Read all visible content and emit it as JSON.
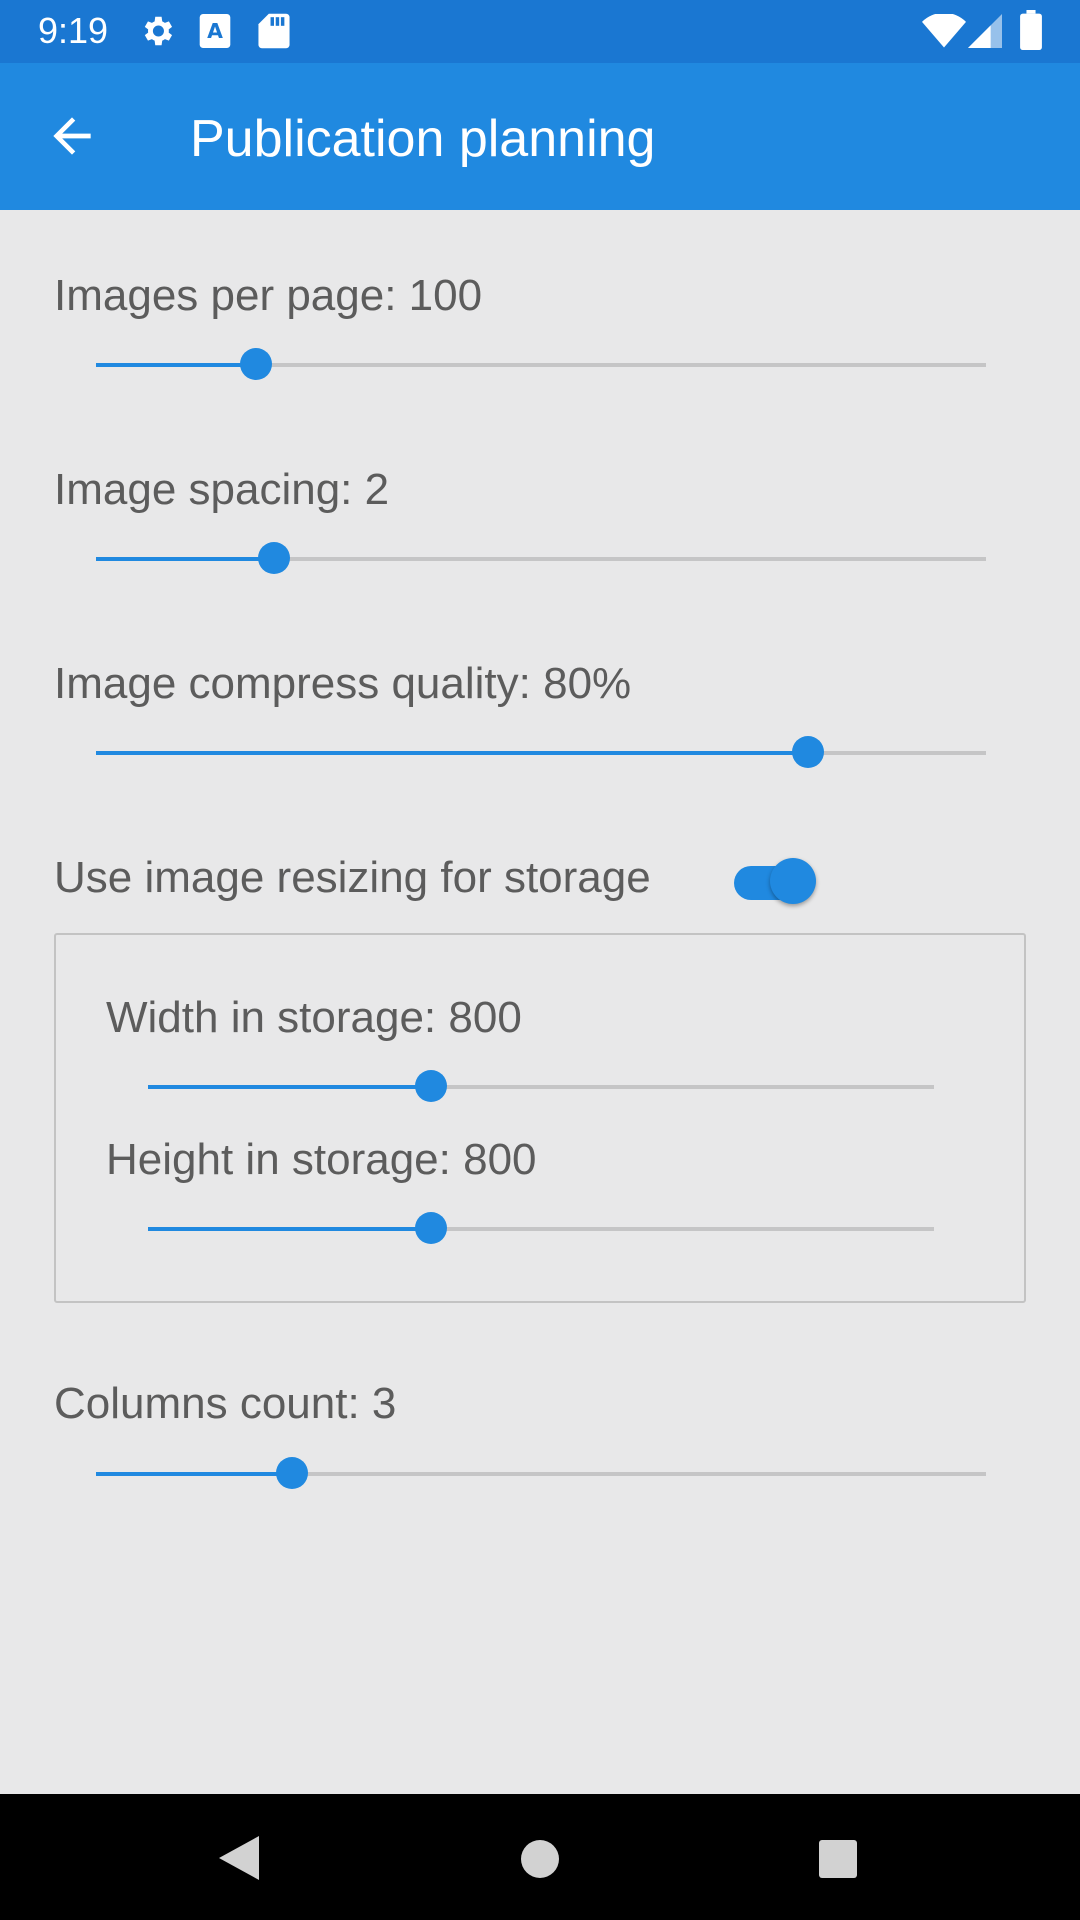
{
  "status_bar": {
    "time": "9:19",
    "left_icons": [
      "gear-icon",
      "font-a-icon",
      "sd-card-icon"
    ],
    "right_icons": [
      "wifi-icon",
      "signal-icon",
      "battery-icon"
    ]
  },
  "app_bar": {
    "back_icon": "arrow-back-icon",
    "title": "Publication planning"
  },
  "settings": {
    "images_per_page": {
      "label": "Images per page: 100",
      "progress": 0.18
    },
    "image_spacing": {
      "label": "Image spacing: 2",
      "progress": 0.2
    },
    "image_compress_quality": {
      "label": "Image compress quality: 80%",
      "progress": 0.8
    },
    "resize_toggle": {
      "label": "Use image resizing for storage",
      "checked": true
    },
    "width_in_storage": {
      "label": "Width in storage: 800",
      "progress": 0.36
    },
    "height_in_storage": {
      "label": "Height in storage: 800",
      "progress": 0.36
    },
    "columns_count": {
      "label": "Columns count: 3",
      "progress": 0.22
    }
  },
  "nav_bar": {
    "items": [
      "back-triangle-icon",
      "home-circle-icon",
      "recents-square-icon"
    ]
  },
  "colors": {
    "status_bar": "#1a77d2",
    "app_bar": "#2089e0",
    "accent": "#2089e0",
    "background": "#e8e8e9",
    "track": "#c5c5c6"
  }
}
